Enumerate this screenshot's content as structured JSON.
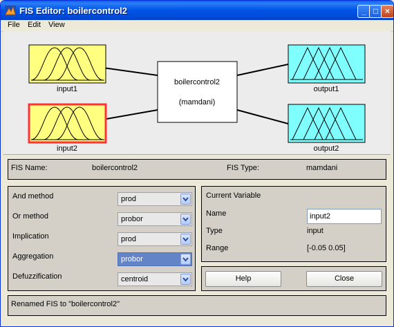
{
  "window": {
    "title": "FIS Editor: boilercontrol2"
  },
  "menu": [
    "File",
    "Edit",
    "View"
  ],
  "diagram": {
    "inputs": [
      {
        "label": "input1",
        "selected": false
      },
      {
        "label": "input2",
        "selected": true
      }
    ],
    "outputs": [
      {
        "label": "output1"
      },
      {
        "label": "output2"
      }
    ],
    "system": {
      "name": "boilercontrol2",
      "type": "(mamdani)"
    },
    "colors": {
      "input_fill": "#ffff80",
      "output_fill": "#80ffff",
      "selected_border": "#ff3333"
    }
  },
  "fis": {
    "name_label": "FIS Name:",
    "name_value": "boilercontrol2",
    "type_label": "FIS Type:",
    "type_value": "mamdani"
  },
  "methods": [
    {
      "label": "And method",
      "value": "prod"
    },
    {
      "label": "Or method",
      "value": "probor"
    },
    {
      "label": "Implication",
      "value": "prod"
    },
    {
      "label": "Aggregation",
      "value": "probor"
    },
    {
      "label": "Defuzzification",
      "value": "centroid"
    }
  ],
  "current_variable": {
    "title": "Current Variable",
    "name_label": "Name",
    "name_value": "input2",
    "type_label": "Type",
    "type_value": "input",
    "range_label": "Range",
    "range_value": "[-0.05 0.05]"
  },
  "buttons": {
    "help": "Help",
    "close": "Close"
  },
  "status": "Renamed FIS to \"boilercontrol2\""
}
